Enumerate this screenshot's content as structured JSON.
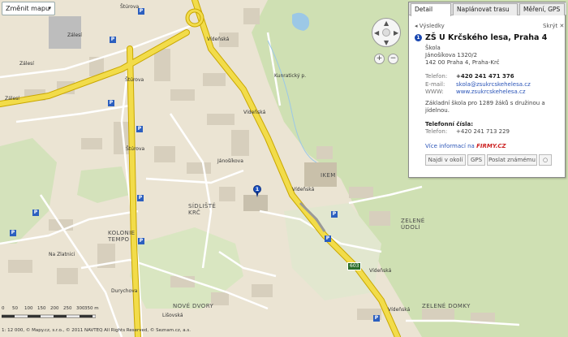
{
  "map": {
    "change_map_label": "Změnit mapu",
    "areas": [
      {
        "name": "SÍDLIŠTĚ",
        "sub": "KRČ"
      },
      {
        "name": "KOLONIE",
        "sub": "TEMPO"
      },
      {
        "name": "NOVÉ DVORY",
        "sub": ""
      },
      {
        "name": "ZELENÉ",
        "sub": "ÚDOLÍ"
      },
      {
        "name": "ZELENÉ DOMKY",
        "sub": ""
      },
      {
        "name": "IKEM",
        "sub": ""
      }
    ],
    "streets": [
      "Zálesí",
      "Zálesí",
      "Zálesí",
      "Štúrova",
      "Štúrova",
      "Štúrova",
      "Vídeňská",
      "Vídeňská",
      "Vídeňská",
      "Vídeňská",
      "Vídeňská",
      "Jánošíkova",
      "Kunratický p.",
      "Na Zlatnici",
      "Durychova",
      "Lišovská",
      "Vídeňská"
    ],
    "road_number": "603",
    "marker_label": "1",
    "parking_icon": "P",
    "scale": {
      "labels": [
        "0",
        "50",
        "100",
        "150",
        "200",
        "250",
        "300",
        "350 m"
      ]
    },
    "copyright": "1: 12 000, © Mapy.cz, s.r.o., © 2011 NAVTEQ All Rights Reserved, © Seznam.cz, a.s.",
    "icons": {
      "pan": "pan-control-icon",
      "zoom_in": "zoom-in-icon",
      "zoom_out": "zoom-out-icon"
    }
  },
  "panel": {
    "tabs": [
      "Detail",
      "Naplánovat trasu",
      "Měření, GPS"
    ],
    "back": "◂ Výsledky",
    "close": "Skrýt ✕",
    "marker": "1",
    "title": "ZŠ U Krčského lesa, Praha 4",
    "category": "Škola",
    "address1": "Jánošíkova 1320/2",
    "address2": "142 00 Praha 4, Praha-Krč",
    "phone_label": "Telefon:",
    "phone": "+420 241 471 376",
    "email_label": "E-mail:",
    "email": "skola@zsukrcskehelesa.cz",
    "www_label": "WWW:",
    "www": "www.zsukrcskehelesa.cz",
    "desc1": "Základní škola pro 1289 žáků s družinou a",
    "desc2": "jídelnou.",
    "phones_heading": "Telefonní čísla:",
    "phone2_label": "Telefon:",
    "phone2": "+420 241 713 229",
    "more_info": "Více informací na",
    "firmy": "FIRMY.CZ",
    "buttons": [
      "Najdi v okolí",
      "GPS",
      "Poslat známému",
      "○"
    ]
  }
}
